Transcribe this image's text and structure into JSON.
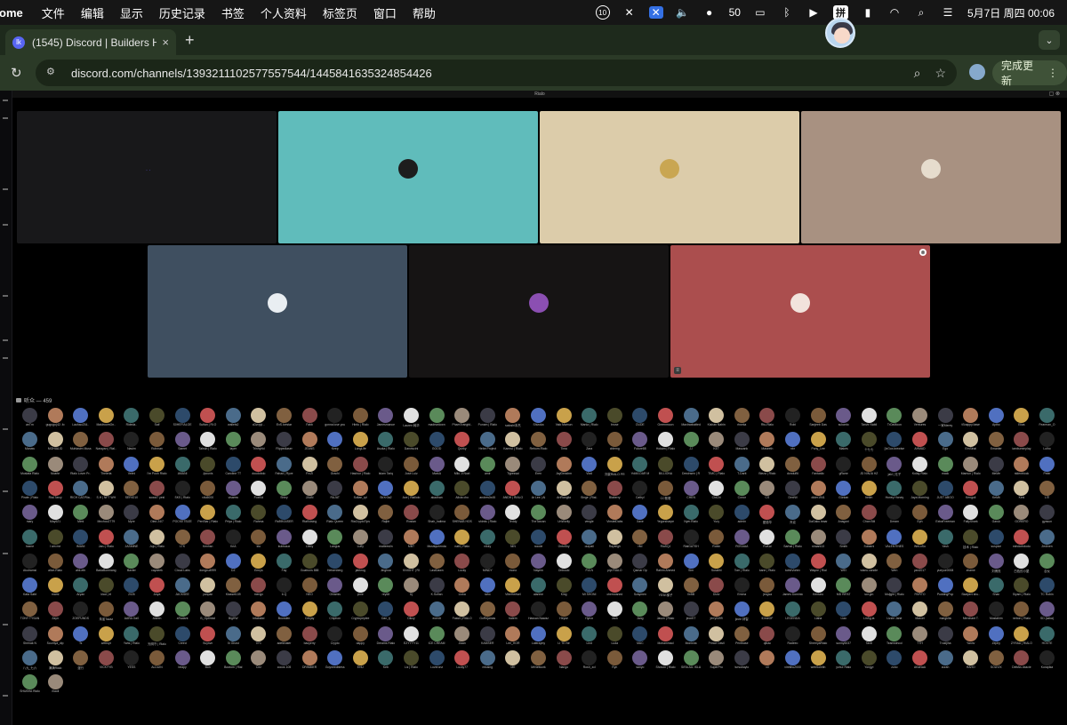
{
  "menubar": {
    "app_name": "rome",
    "items": [
      "文件",
      "编辑",
      "显示",
      "历史记录",
      "书签",
      "个人资料",
      "标签页",
      "窗口",
      "帮助"
    ],
    "status": {
      "notif_badge": "10",
      "input_method": "拼",
      "wechat_count": "50",
      "datetime": "5月7日 周四  00:06"
    }
  },
  "browser": {
    "tab_title": "(1545) Discord | Builders Hub",
    "favicon_label": "lk",
    "new_tab": "+",
    "url": "discord.com/channels/1393211102577557544/1445841635324854426",
    "update_label": "完成更新"
  },
  "stream": {
    "title": "Rialo"
  },
  "stage_tiles": [
    {
      "color": "#18181a",
      "avatar": "#1b1b20",
      "kind": "dots"
    },
    {
      "color": "#60bcbb",
      "avatar": "#1d1d1d"
    },
    {
      "color": "#dcccaa",
      "avatar": "#c9a652"
    },
    {
      "color": "#a89181",
      "avatar": "#e6dccd"
    },
    {
      "color": "#3f4f60",
      "avatar": "#e9eef2"
    },
    {
      "color": "#161414",
      "avatar": "#8b4fb2"
    },
    {
      "color": "#ab4e4e",
      "avatar": "#f2e3dc",
      "corner": "⊗",
      "mute": "≡"
    }
  ],
  "audience": {
    "label": "听众 — 459",
    "names": [
      "anTm",
      "gugugu(42..fo",
      "Lauhao234..",
      "MaidroomOn..",
      "Rideda..",
      "Saif",
      "S0HEFIALOE",
      "Sufian | Rl.O",
      "wallets2",
      "cDzrpyi...",
      "ExS.Icestar",
      "Fabb",
      "gonna lose you",
      "Hintu | Rialo",
      "Jamesmance",
      "Lauren 韩华",
      "madewdown",
      "PhamTrangtd..",
      "Punam | Rialo",
      "satoshi本杰",
      "Shizuka",
      "Valo Mamun",
      "Mania | Rialo",
      "bruse",
      "DUDE",
      "Greenmoon",
      "Maxtraxbatted",
      "Kishan Nahin",
      "rtweka",
      "Rtu-Rialo",
      "Robi",
      "Sanjeeb Das",
      "sukanto",
      "Tanvir Nabil",
      "TrOaMoon",
      "Ventures",
      "一家Merey",
      "tSnappy.base",
      "Aytho",
      "Elias",
      "Fearman_O",
      "Manaw",
      "MOHIALID",
      "Muhtasim Muss",
      "Narayan | Rial..",
      "Nasim",
      "Rohman",
      "Samet",
      "Tahsin | Rialo",
      "layer",
      "Trinhyhki",
      "Flippedlaser",
      "JEANS",
      "Keep",
      "LongLife",
      "Asuka | Rialo",
      "Danviscini",
      "GOOD",
      "Quirky",
      "Hebe Project",
      "Kamrul | Rialo",
      "Reborn.Rialo",
      "Tima",
      "Zara",
      "cblemg",
      "Future88",
      "Hokam | Rialo",
      "JJ",
      "KET",
      "Mascank",
      "Maseeth",
      "nbr",
      "Pony_Lee",
      "Makes",
      "十七七",
      "[IxGox.brewise",
      "AHMAD",
      "Ego",
      "EmSinai",
      "Emanter",
      "iambummplay",
      "Lolho",
      "Mustafa Rialo",
      "Noarte",
      "Rialo Lover Pr..",
      "Theleria",
      "Velmi",
      "I'm Pooh Rialo",
      "AMANI",
      "Jpcunis",
      "Caroline TT",
      "doudobdo",
      "Fahad | Ryve",
      "FroZi",
      "Grachi",
      "Hasinur | Rialo",
      "Islam Tariq",
      "José Luiz",
      "MarkA",
      "Milu Jl Nuzt",
      "amir",
      "Tigressai",
      "Eren",
      "JayDecsbm",
      "Vlad",
      "刘豪RIALO PR",
      "YoMA DAR M",
      "BILLIONA",
      "Dewinsen | R",
      "TIMC | Rialo",
      "T-Dartt",
      "Bleza | Rialo",
      "dondufl6",
      "Fantastic",
      "gRamr",
      "JD NINJA HZ",
      "jakl | 无子",
      "Kolay-Rialo",
      "mack",
      "Mamun | Rialo",
      "MeMe",
      "nidentriock",
      "Peter",
      "Pirate | Rialo",
      "Rial.Tarzy",
      "RICH CAT/Ria..",
      "S.H | NFT WH",
      "SERIO10",
      "sowol7 yes!",
      "SKS | Rialo",
      "vitu5000",
      "visamw",
      "FoxKid",
      "Shiny",
      "JAAN",
      "RAJAT",
      "Sultan_rpl",
      "SirXr3a2",
      "Ace | Rialiolo",
      "akadhan",
      "Alicia cho",
      "andres0x45",
      "ANDH | RIALO",
      "Ar Lee | Al",
      "ArtRanglia",
      "Singe | Rial..",
      "Blaberry",
      "Cathy!",
      "CC爸爸",
      "CHEN",
      "ChiChi",
      "Conor",
      "CS",
      "DexNil",
      "dider1941",
      "Gürkan",
      "hellm",
      "Honey Honey",
      "Jaya Morning",
      "JUST ABOO",
      "Kenguli",
      "KeMit",
      "Kimi",
      "LiTi",
      "mary",
      "May621",
      "Mimi",
      "Mnchoo2779",
      "Myre",
      "Oled 24/7",
      "POCKETSIZE",
      "PenStar | Rialo",
      "Priya | Rialo",
      "Rahma",
      "Rx89KAISER",
      "RiaKidsing",
      "Rialo Queen",
      "RiaCryptoTips",
      "Rajbir",
      "Rostan",
      "Shah_halima",
      "SHENAB HOS",
      "shimis | Rialo",
      "Teddy",
      "TheTarzan",
      "UnWorlly",
      "vengle",
      "VinstelDabs",
      "Xaxe",
      "Yegorsharpe",
      "Nyer.Rialo",
      "Yury",
      "admin",
      "爱德华",
      "乔克",
      "DaGaku.ieaar",
      "Anagoni",
      "Chan Bili",
      "Dream",
      "Eph",
      "ExtraFreeman",
      "FallyShark",
      "Garuk",
      "GORERO",
      "gyasun",
      "hazne",
      "I am me",
      "IMANI",
      "Jaru | Rialo",
      "JASMINE",
      "Jojo | Rialo",
      "LTK",
      "Kenhsn",
      "KriA",
      "kto",
      "kubisaux",
      "Libby",
      "Langus",
      "Luffy",
      "matteeslin",
      "MBT",
      "Mustiqueenda",
      "natil | Rialo",
      "nikky",
      "NIN",
      "noode",
      "OntoSky",
      "ourpall",
      "Rayleigh",
      "rftd",
      "RiaSQJ",
      "RialGATSH",
      "Robin",
      "ROSAAA",
      "RuKai",
      "Sarhat | Rialo",
      "shaark13",
      "Smith",
      "Subarni",
      "VALENTINES",
      "WeLoSu",
      "Yash",
      "技术 | Rialo",
      "suspice",
      "mindorbdodu",
      "Zedinen",
      "Akutramsi",
      "alice-Rialo",
      "ahk.eth",
      "BadaBomnang",
      "Baxter",
      "caydeek",
      "Cloud Labs",
      "dongxu4999",
      "DZ",
      "Emrys",
      "Fay",
      "Goatruns 888",
      "Heisenberg",
      "jabkrog",
      "Jinghua",
      "KNIGHT | RI",
      "LastDawn",
      "Lucky",
      "MINDY",
      "mono",
      "Nayem",
      "Onbouki",
      "P.A.N",
      "pipi RIALO",
      "Qamar Op",
      "Rahim Ahmed",
      "Sim",
      "Surabhi",
      "Tom | Rialo",
      "kane | Rialo",
      "tulnbVortex",
      "Wayne | Rial",
      "WEI",
      "wisnu.candle",
      "Wen",
      "yan2017",
      "yueyue0008",
      "zhamir",
      "刘博亮",
      "白色的小屋",
      "合伙",
      "Kata Sabt",
      "rnami",
      "Aryan",
      "klad | el",
      "2026",
      "Anya",
      "JACKSEE",
      "yanpan",
      "Klasset139",
      "mengx",
      "b.Q",
      "NEO",
      "Ohlamis",
      "pixie",
      "rey68",
      "Dj",
      "K.Sufian",
      "Lioka",
      "raho",
      "VibeHertsel",
      "alarime",
      "King",
      "MI SHONI",
      "cherrwaned",
      "Szaymen",
      "YESE梯子",
      "0xBB",
      "Diolv",
      "Emma",
      "(exgsa",
      "James Dominic",
      "Kentaro",
      "MD RIFAT",
      "sor.gm",
      "Muljght | Rialo",
      "PAPITO",
      "PuddingPop",
      "Skalpert shu..",
      "Shan",
      "Siyam | Rialo",
      "TC Robin",
      "TONY TYSAN",
      "Zayn",
      "ZOEFUNDS",
      "朱雀Tazaz",
      "AARA Oa0",
      "Aldren",
      "aTsalant",
      "B_Optimist",
      "BigHW",
      "bitababd",
      "Bounden",
      "Cekjay",
      "Chiphon",
      "Cryptopeplee",
      "Dan_tj",
      "Dikcy",
      "ecentt",
      "Fassil | RIALO",
      "GoRejamas",
      "hatem",
      "Hassan Nawaz",
      "Heyse",
      "Hyrox",
      "Jack",
      "Jang",
      "Jason | Rialo",
      "jeonKT",
      "jerry0499",
      "jinee 林智",
      "IDmeOF",
      "LEGENDA",
      "Liaha",
      "Liao",
      "LinSg.la",
      "Lizzie Jane",
      "Marcel",
      "margkita",
      "Merchant T.",
      "Mustahim",
      "nebon | Rialo",
      "SD (saka)",
      "Shenak N",
      "Soumya_dip",
      "Ts",
      "webspt",
      "Yahs | Rialo",
      "光明守 | Rialo",
      "Creed",
      "Suysvn",
      "Xi Ghost",
      "0Y1",
      "adelkhater",
      "baoyerty",
      "Crypto",
      "dappy",
      "Dreams Rialo",
      "EZYYYY11",
      "ICE CREAM",
      "Jiaan",
      "KAMSER",
      "Lee_HOR",
      "Lateraphy",
      "LI TE Ne",
      "Lind",
      "Luda",
      "MAC",
      "Mohammad",
      "Monisha",
      "Prince Davil",
      "Printbase",
      "qtbac",
      "Radeeo",
      "ShreeyaRialo",
      "sunny6037",
      "Tardi",
      "Teamwincoi",
      "TTH",
      "Trustjiha",
      "Yannv",
      "Zephy",
      "ZYRAA | RIALO",
      "HOXTE",
      "八九_七六",
      "满满Rialo",
      "漫行",
      "VICKYYB",
      "YESS",
      "ALDUIN",
      "beapy",
      "Bon",
      "Bootom | Rial",
      "Cez",
      "cocos 105",
      "DRIMMER",
      "Goyneedbless",
      "EHU",
      "Keb",
      "Liz | Rialo",
      "Loveronz",
      "Lucky77",
      "missing",
      "MK",
      "MrNetwork",
      "Nango",
      "Rosh_zcl",
      "Ryn",
      "sanyo",
      "Shovon | Rialo",
      "SIRAJUL ISLA",
      "SuperPro",
      "tursubaylo",
      "vil",
      "vinhthu2000",
      "webSolnfin",
      "yohu! Rialo",
      "Yongyi",
      "zuno",
      "AKaNaA",
      "zurah",
      "HAHO",
      "SOUVIX",
      "DeltAis.dxacie",
      "Kurapika",
      "SHUBHA Rialo",
      "Xiaoli"
    ]
  }
}
